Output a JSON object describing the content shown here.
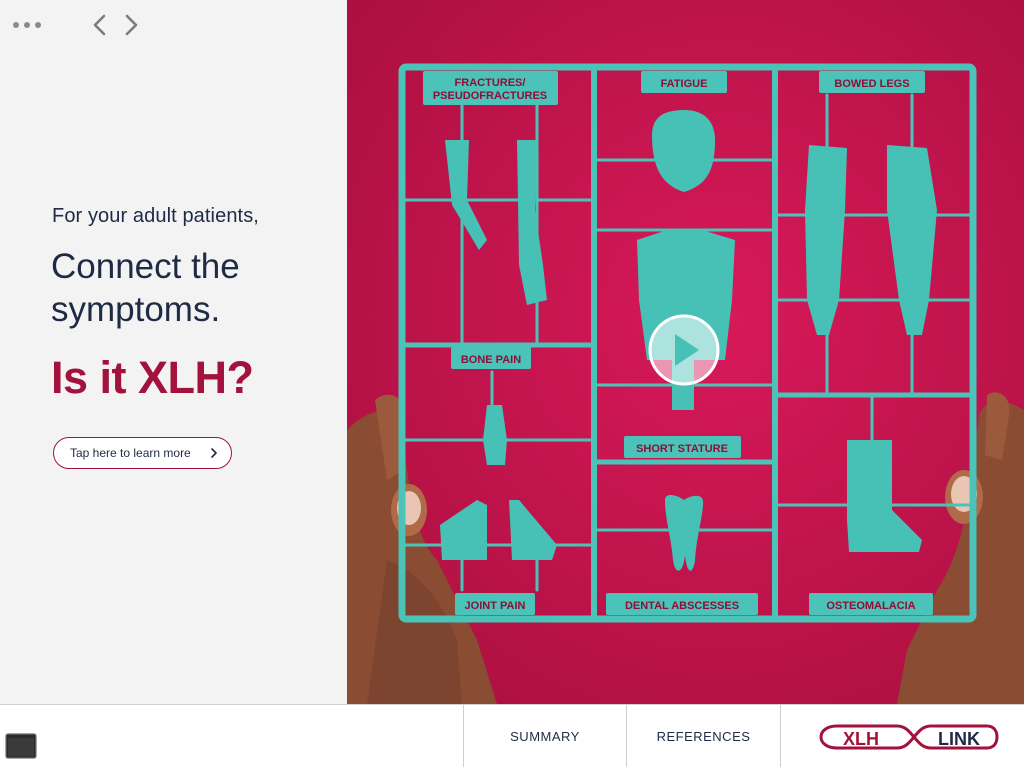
{
  "intro": "For your adult patients,",
  "headline": "Connect the symptoms.",
  "question": "Is it XLH?",
  "cta": {
    "label": "Tap here to learn more"
  },
  "hero": {
    "labels": {
      "fractures_line1": "FRACTURES/",
      "fractures_line2": "PSEUDOFRACTURES",
      "fatigue": "FATIGUE",
      "bowed_legs": "BOWED LEGS",
      "bone_pain": "BONE PAIN",
      "short_stature": "SHORT STATURE",
      "joint_pain": "JOINT PAIN",
      "dental_abscesses": "DENTAL ABSCESSES",
      "osteomalacia": "OSTEOMALACIA"
    }
  },
  "bottom_bar": {
    "summary": "SUMMARY",
    "references": "REFERENCES",
    "logo_left": "XLH",
    "logo_right": "LINK"
  },
  "colors": {
    "brand": "#a3123c",
    "navy": "#1f2a44",
    "hero_bg": "#c8154a",
    "teal": "#47c1b6"
  },
  "icons": [
    "more-icon",
    "chevron-left-icon",
    "chevron-right-icon",
    "chevron-right-icon",
    "play-icon",
    "screen-icon"
  ]
}
